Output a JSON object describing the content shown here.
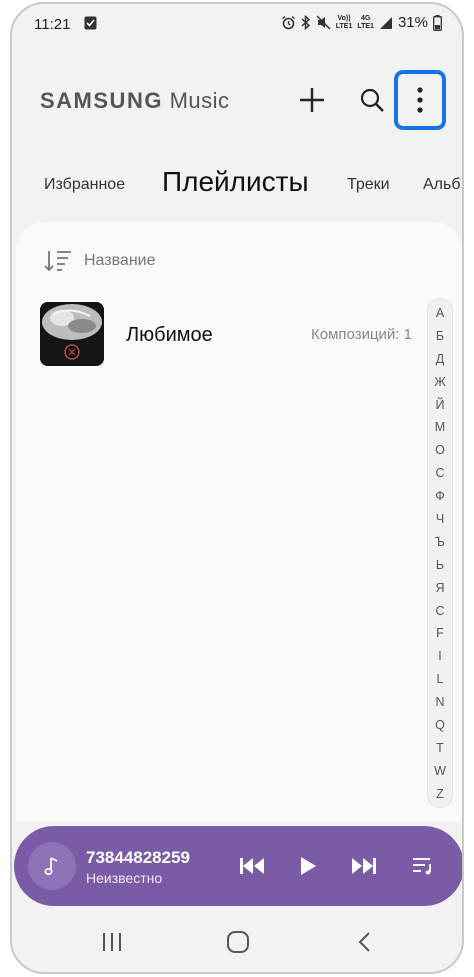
{
  "status_bar": {
    "time": "11:21",
    "battery": "31%",
    "volte_top": "Vo))",
    "volte_bottom": "LTE1",
    "network": "4G",
    "network_bars": "LTE1"
  },
  "header": {
    "brand_bold": "SAMSUNG",
    "brand_light": "Music",
    "add_icon": "plus-icon",
    "search_icon": "search-icon",
    "more_icon": "more-vertical-icon",
    "highlight_color": "#1473e6"
  },
  "tabs": [
    {
      "label": "Избранное",
      "active": false
    },
    {
      "label": "Плейлисты",
      "active": true
    },
    {
      "label": "Треки",
      "active": false
    },
    {
      "label": "Альб",
      "active": false
    }
  ],
  "sort": {
    "label": "Название",
    "icon": "sort-icon"
  },
  "playlists": [
    {
      "title": "Любимое",
      "count": "Композиций: 1"
    }
  ],
  "index_letters": [
    "А",
    "Б",
    "Д",
    "Ж",
    "Й",
    "М",
    "О",
    "С",
    "Ф",
    "Ч",
    "Ъ",
    "Ь",
    "Я",
    "C",
    "F",
    "I",
    "L",
    "N",
    "Q",
    "T",
    "W",
    "Z"
  ],
  "player": {
    "title": "73844828259",
    "artist": "Неизвестно",
    "color": "#7b5ba6",
    "icons": [
      "music-note-icon",
      "previous-icon",
      "play-icon",
      "next-icon",
      "queue-icon"
    ]
  },
  "navbar": {
    "icons": [
      "recent-apps-icon",
      "home-icon",
      "back-icon"
    ]
  }
}
